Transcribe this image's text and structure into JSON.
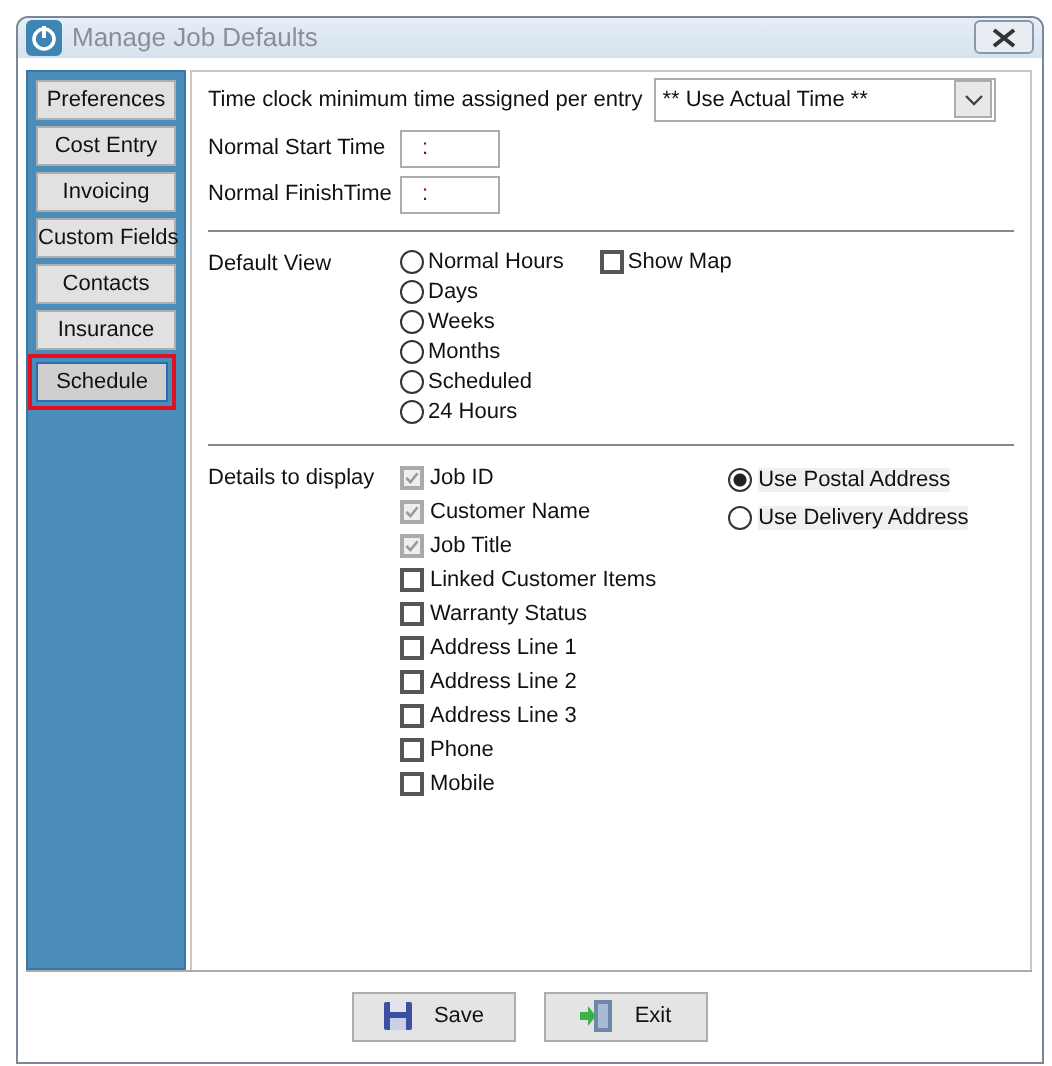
{
  "window": {
    "title": "Manage Job Defaults"
  },
  "sidebar": {
    "items": [
      {
        "label": "Preferences",
        "selected": false
      },
      {
        "label": "Cost Entry",
        "selected": false
      },
      {
        "label": "Invoicing",
        "selected": false
      },
      {
        "label": "Custom Fields",
        "selected": false
      },
      {
        "label": "Contacts",
        "selected": false
      },
      {
        "label": "Insurance",
        "selected": false
      },
      {
        "label": "Schedule",
        "selected": true
      }
    ]
  },
  "time_clock": {
    "label": "Time clock minimum time assigned per entry",
    "value": "** Use Actual Time **"
  },
  "times": [
    {
      "label": "Normal Start Time",
      "value": ":"
    },
    {
      "label": "Normal FinishTime",
      "value": ":"
    }
  ],
  "default_view": {
    "label": "Default View",
    "options": [
      {
        "label": "Normal Hours",
        "selected": false
      },
      {
        "label": "Days",
        "selected": false
      },
      {
        "label": "Weeks",
        "selected": false
      },
      {
        "label": "Months",
        "selected": false
      },
      {
        "label": "Scheduled",
        "selected": false
      },
      {
        "label": "24 Hours",
        "selected": false
      }
    ],
    "show_map": {
      "label": "Show Map",
      "checked": false
    }
  },
  "details": {
    "label": "Details to display",
    "items": [
      {
        "label": "Job ID",
        "checked": true,
        "disabled": true
      },
      {
        "label": "Customer Name",
        "checked": true,
        "disabled": true
      },
      {
        "label": "Job Title",
        "checked": true,
        "disabled": true
      },
      {
        "label": "Linked Customer Items",
        "checked": false,
        "disabled": false
      },
      {
        "label": "Warranty Status",
        "checked": false,
        "disabled": false
      },
      {
        "label": "Address Line 1",
        "checked": false,
        "disabled": false
      },
      {
        "label": "Address Line 2",
        "checked": false,
        "disabled": false
      },
      {
        "label": "Address Line 3",
        "checked": false,
        "disabled": false
      },
      {
        "label": "Phone",
        "checked": false,
        "disabled": false
      },
      {
        "label": "Mobile",
        "checked": false,
        "disabled": false
      }
    ],
    "address": [
      {
        "label": "Use Postal Address",
        "selected": true
      },
      {
        "label": "Use Delivery Address",
        "selected": false
      }
    ]
  },
  "buttons": [
    {
      "label": "Save",
      "kind": "save"
    },
    {
      "label": "Exit",
      "kind": "exit"
    }
  ]
}
